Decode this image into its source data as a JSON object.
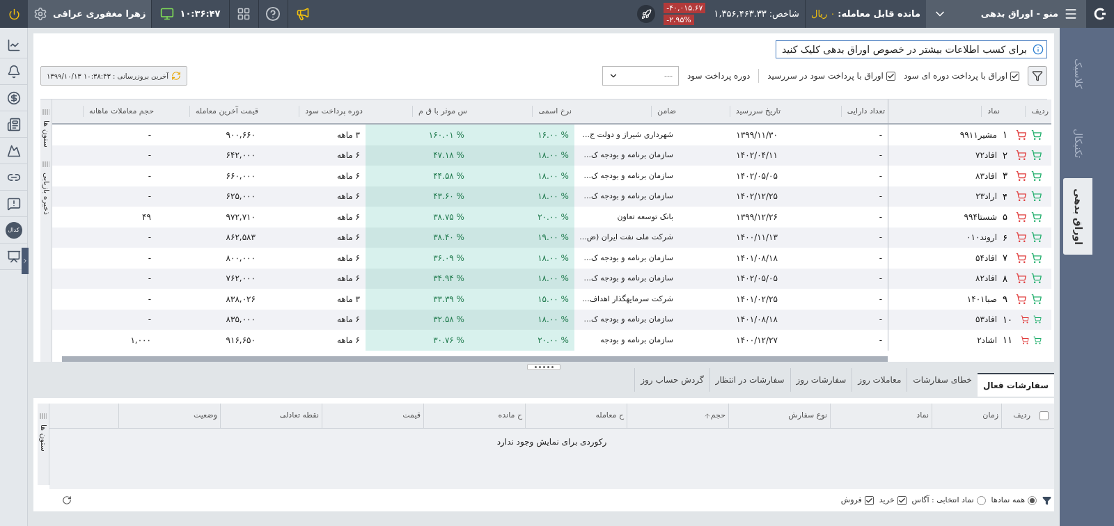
{
  "topbar": {
    "user": "زهرا مغفوری عراقی",
    "time": "۱۰:۳۶:۴۷",
    "change_value": "-۴۰,۰۱۵.۶۷",
    "change_percent": "-۲.۹۵%",
    "index_label": "شاخص:",
    "index_value": "۱,۳۵۶,۴۶۳.۳۳",
    "balance_label": "مانده قابل معامله:",
    "balance_value": "۰ ریال",
    "menu_title": "منو - اوراق بدهی"
  },
  "sidebar": {
    "badge": "کدال"
  },
  "info_link": "برای کسب اطلاعات بیشتر در خصوص اوراق بدهی کلیک کنید",
  "filters": [
    {
      "label": "اوراق با پرداخت دوره ای سود",
      "checked": true
    },
    {
      "label": "اوراق با پرداخت سود در سررسید",
      "checked": true
    }
  ],
  "period": {
    "label": "دوره پرداخت سود",
    "value": "---"
  },
  "last_update": "آخرین بروزرسانی : ۱۰:۳۸:۴۳ ۱۳۹۹/۱۰/۱۳",
  "strip_labels": [
    "ستون ها",
    "ذخیره بازیابی"
  ],
  "table": {
    "columns": [
      "ردیف",
      "نماد",
      "تعداد دارایی",
      "تاریخ سررسید",
      "ضامن",
      "نرخ اسمی",
      "س موثر با ق م",
      "دوره پرداخت سود",
      "قیمت آخرین معامله",
      "حجم معاملات ماهانه"
    ],
    "rows": [
      {
        "row": "۱",
        "symbol": "مشیر۹۹۱۱",
        "holding": "-",
        "maturity": "۱۳۹۹/۱۱/۳۰",
        "guarantor": "شهرداري شیراز و دولت ج...",
        "nominal_rate": "% ۱۶.۰۰",
        "ytm": "% ۱۶۰.۰۱",
        "period": "۳ ماهه",
        "last_price": "۹۰۰,۶۶۰",
        "monthly_volume": "-"
      },
      {
        "row": "۲",
        "symbol": "افاد۷۲",
        "holding": "-",
        "maturity": "۱۴۰۲/۰۴/۱۱",
        "guarantor": "سازمان برنامه و بودجه ک...",
        "nominal_rate": "% ۱۸.۰۰",
        "ytm": "% ۴۷.۱۸",
        "period": "۶ ماهه",
        "last_price": "۶۴۲,۰۰۰",
        "monthly_volume": "-"
      },
      {
        "row": "۳",
        "symbol": "افاد۸۳",
        "holding": "-",
        "maturity": "۱۴۰۲/۰۵/۰۵",
        "guarantor": "سازمان برنامه و بودجه ک...",
        "nominal_rate": "% ۱۸.۰۰",
        "ytm": "% ۴۴.۵۸",
        "period": "۶ ماهه",
        "last_price": "۶۶۰,۰۰۰",
        "monthly_volume": "-"
      },
      {
        "row": "۴",
        "symbol": "اراد۲۳",
        "holding": "-",
        "maturity": "۱۴۰۲/۱۲/۲۵",
        "guarantor": "سازمان برنامه و بودجه ک...",
        "nominal_rate": "% ۱۸.۰۰",
        "ytm": "% ۴۳.۶۰",
        "period": "۶ ماهه",
        "last_price": "۶۲۵,۰۰۰",
        "monthly_volume": "-"
      },
      {
        "row": "۵",
        "symbol": "شستا۹۹۴",
        "holding": "-",
        "maturity": "۱۳۹۹/۱۲/۲۶",
        "guarantor": "بانک توسعه تعاون",
        "nominal_rate": "% ۲۰.۰۰",
        "ytm": "% ۳۸.۷۵",
        "period": "۶ ماهه",
        "last_price": "۹۷۲,۷۱۰",
        "monthly_volume": "۴۹"
      },
      {
        "row": "۶",
        "symbol": "اروند۰۱۰",
        "holding": "-",
        "maturity": "۱۴۰۰/۱۱/۱۳",
        "guarantor": "شرکت ملی نفت ایران (ض...",
        "nominal_rate": "% ۱۹.۰۰",
        "ytm": "% ۳۸.۴۰",
        "period": "۶ ماهه",
        "last_price": "۸۶۲,۵۸۳",
        "monthly_volume": "-"
      },
      {
        "row": "۷",
        "symbol": "افاد۵۴",
        "holding": "-",
        "maturity": "۱۴۰۱/۰۸/۱۸",
        "guarantor": "سازمان برنامه و بودجه ک...",
        "nominal_rate": "% ۱۸.۰۰",
        "ytm": "% ۳۶.۰۹",
        "period": "۶ ماهه",
        "last_price": "۸۰۰,۰۰۰",
        "monthly_volume": "-"
      },
      {
        "row": "۸",
        "symbol": "افاد۸۲",
        "holding": "-",
        "maturity": "۱۴۰۲/۰۵/۰۵",
        "guarantor": "سازمان برنامه و بودجه ک...",
        "nominal_rate": "% ۱۸.۰۰",
        "ytm": "% ۳۴.۹۴",
        "period": "۶ ماهه",
        "last_price": "۷۶۲,۰۰۰",
        "monthly_volume": "-"
      },
      {
        "row": "۹",
        "symbol": "صبا۱۴۰۱",
        "holding": "-",
        "maturity": "۱۴۰۱/۰۲/۲۵",
        "guarantor": "شرکت سرمایهگذار اهداف...",
        "nominal_rate": "% ۱۵.۰۰",
        "ytm": "% ۳۳.۳۹",
        "period": "۳ ماهه",
        "last_price": "۸۳۸,۰۲۶",
        "monthly_volume": "-"
      },
      {
        "row": "۱۰",
        "symbol": "افاد۵۳",
        "holding": "-",
        "maturity": "۱۴۰۱/۰۸/۱۸",
        "guarantor": "سازمان برنامه و بودجه ک...",
        "nominal_rate": "% ۱۸.۰۰",
        "ytm": "% ۳۲.۵۸",
        "period": "۶ ماهه",
        "last_price": "۸۳۵,۰۰۰",
        "monthly_volume": "-"
      },
      {
        "row": "۱۱",
        "symbol": "اشاد۲",
        "holding": "-",
        "maturity": "۱۴۰۰/۱۲/۲۷",
        "guarantor": "سازمان برنامه و بودجه",
        "nominal_rate": "% ۲۰.۰۰",
        "ytm": "% ۳۰.۷۶",
        "period": "۶ ماهه",
        "last_price": "۹۱۶,۶۵۰",
        "monthly_volume": "۱,۰۰۰"
      }
    ]
  },
  "side_tabs": [
    {
      "label": "کلاسیک",
      "selected": false
    },
    {
      "label": "تکنیکال",
      "selected": false
    },
    {
      "label": "اوراق بدهی",
      "selected": true
    }
  ],
  "orders": {
    "tabs": [
      {
        "label": "سفارشات فعال",
        "selected": true
      },
      {
        "label": "خطای سفارشات",
        "selected": false
      },
      {
        "label": "معاملات روز",
        "selected": false
      },
      {
        "label": "سفارشات روز",
        "selected": false
      },
      {
        "label": "سفارشات در انتظار",
        "selected": false
      },
      {
        "label": "گردش حساب روز",
        "selected": false
      }
    ],
    "select_all": false,
    "columns": [
      {
        "label": "ردیف",
        "sorted": false
      },
      {
        "label": "زمان",
        "sorted": false
      },
      {
        "label": "نماد",
        "sorted": false
      },
      {
        "label": "نوع سفارش",
        "sorted": false
      },
      {
        "label": "حجم",
        "sorted": true
      },
      {
        "label": "ح معامله",
        "sorted": false
      },
      {
        "label": "ح مانده",
        "sorted": false
      },
      {
        "label": "قیمت",
        "sorted": false
      },
      {
        "label": "نقطه تعادلی",
        "sorted": false
      },
      {
        "label": "وضعیت",
        "sorted": false
      }
    ],
    "strip_label": "ستون ها",
    "empty_message": "رکوردی برای نمایش وجود ندارد",
    "radios": [
      {
        "label": "همه نمادها",
        "selected": true
      },
      {
        "label": "نماد انتخابی : آگاس",
        "selected": false
      }
    ],
    "checks": [
      {
        "label": "خرید",
        "checked": true
      },
      {
        "label": "فروش",
        "checked": true
      }
    ]
  }
}
